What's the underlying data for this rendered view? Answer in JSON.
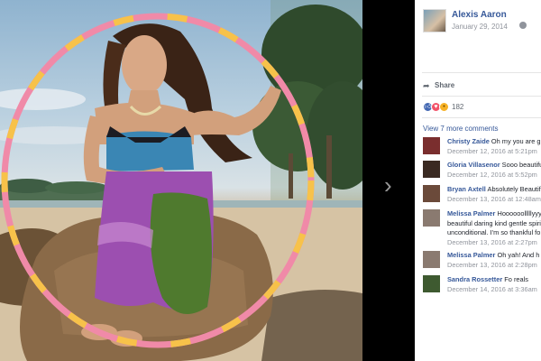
{
  "post": {
    "author": "Alexis Aaron",
    "date": "January 29, 2014",
    "privacy_icon": "globe-icon"
  },
  "actions": {
    "share_label": "Share",
    "share_icon": "share-arrow-icon"
  },
  "reactions": {
    "types": [
      "like",
      "love",
      "wow"
    ],
    "count": "182"
  },
  "comments_section": {
    "view_more": "View 7 more comments",
    "comments": [
      {
        "name": "Christy Zaide",
        "text": "Oh my you are g",
        "date": "December 12, 2016 at 5:21pm"
      },
      {
        "name": "Gloria Villasenor",
        "text": "Sooo beautifu",
        "date": "December 12, 2016 at 5:52pm"
      },
      {
        "name": "Bryan Axtell",
        "text": "Absolutely Beautiful",
        "date": "December 13, 2016 at 12:48am"
      },
      {
        "name": "Melissa Palmer",
        "text": "Hoooooolllllyyy beautiful daring kind gentle spirit unconditional. I'm so thankful fo",
        "date": "December 13, 2016 at 2:27pm"
      },
      {
        "name": "Melissa Palmer",
        "text": "Oh yah! And h",
        "date": "December 13, 2016 at 2:28pm"
      },
      {
        "name": "Sandra Rossetter",
        "text": "Fo reals",
        "date": "December 14, 2016 at 3:36am"
      }
    ]
  },
  "viewer": {
    "next_icon": "chevron-right-icon"
  },
  "colors": {
    "link": "#365899",
    "meta": "#90949c",
    "panel_bg": "#ffffff",
    "viewer_bg": "#000000"
  }
}
